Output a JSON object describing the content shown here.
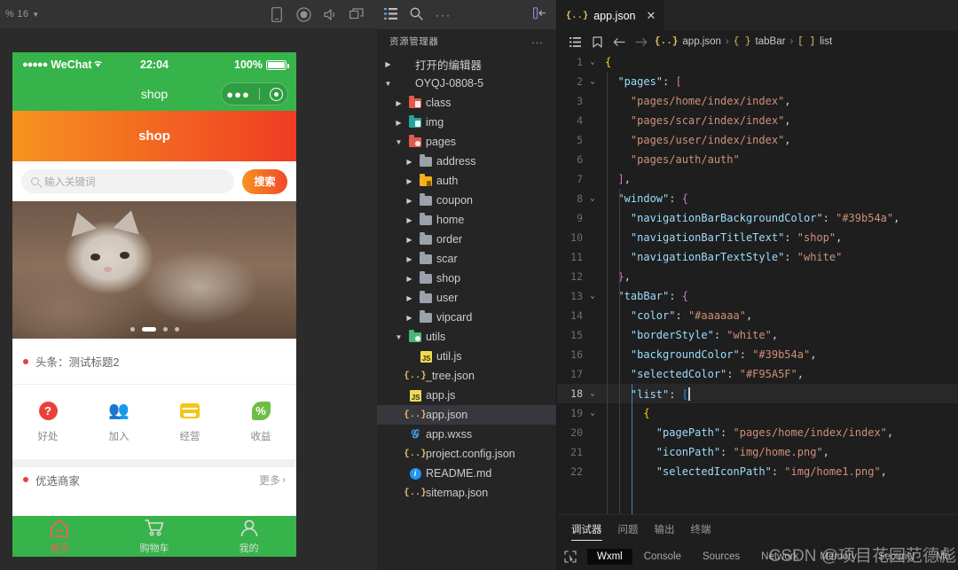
{
  "simulator": {
    "scale_label": "% 16",
    "toolbar_icons": [
      "device-icon",
      "record-icon",
      "volume-icon",
      "windows-icon"
    ],
    "status_bar": {
      "signal_dots": "●●●●●",
      "carrier": "WeChat",
      "wifi": "⌃",
      "time": "22:04",
      "battery_percent": "100%"
    },
    "nav_title": "shop",
    "banner_title": "shop",
    "search": {
      "placeholder": "输入关键词",
      "button_label": "搜索"
    },
    "carousel": {
      "dot_count": 4,
      "active_dot": 2
    },
    "news": {
      "text": "头条：测试标题2"
    },
    "quick_actions": [
      {
        "label": "好处",
        "icon": "help-icon",
        "color": "#e8413a"
      },
      {
        "label": "加入",
        "icon": "join-people-icon",
        "color": "#f7803c"
      },
      {
        "label": "经营",
        "icon": "store-icon",
        "color": "#f5c518"
      },
      {
        "label": "收益",
        "icon": "profit-percent-icon",
        "color": "#6fbe44"
      }
    ],
    "section": {
      "title": "优选商家",
      "more_label": "更多"
    },
    "tabbar": {
      "background": "#36b34a",
      "selected_color": "#F95A5F",
      "items": [
        {
          "label": "首页",
          "icon": "home-icon",
          "selected": true
        },
        {
          "label": "购物车",
          "icon": "cart-icon",
          "selected": false
        },
        {
          "label": "我的",
          "icon": "user-icon",
          "selected": false
        }
      ]
    }
  },
  "explorer": {
    "actions": [
      "list-icon",
      "search-icon",
      "more-icon",
      "collapse-sidebar-icon"
    ],
    "title": "资源管理器",
    "more_label": "...",
    "tree": [
      {
        "label": "打开的编辑器",
        "depth": 0,
        "twisty": "▶",
        "icon": "none",
        "selected": false
      },
      {
        "label": "OYQJ-0808-5",
        "depth": 0,
        "twisty": "▼",
        "icon": "none",
        "selected": false
      },
      {
        "label": "class",
        "depth": 1,
        "twisty": "▶",
        "icon": "folder-red",
        "selected": false
      },
      {
        "label": "img",
        "depth": 1,
        "twisty": "▶",
        "icon": "folder-green",
        "selected": false
      },
      {
        "label": "pages",
        "depth": 1,
        "twisty": "▼",
        "icon": "folder-red-open",
        "selected": false
      },
      {
        "label": "address",
        "depth": 2,
        "twisty": "▶",
        "icon": "folder-grey",
        "selected": false
      },
      {
        "label": "auth",
        "depth": 2,
        "twisty": "▶",
        "icon": "folder-yellow-lock",
        "selected": false
      },
      {
        "label": "coupon",
        "depth": 2,
        "twisty": "▶",
        "icon": "folder-grey",
        "selected": false
      },
      {
        "label": "home",
        "depth": 2,
        "twisty": "▶",
        "icon": "folder-grey",
        "selected": false
      },
      {
        "label": "order",
        "depth": 2,
        "twisty": "▶",
        "icon": "folder-grey",
        "selected": false
      },
      {
        "label": "scar",
        "depth": 2,
        "twisty": "▶",
        "icon": "folder-grey",
        "selected": false
      },
      {
        "label": "shop",
        "depth": 2,
        "twisty": "▶",
        "icon": "folder-grey",
        "selected": false
      },
      {
        "label": "user",
        "depth": 2,
        "twisty": "▶",
        "icon": "folder-grey",
        "selected": false
      },
      {
        "label": "vipcard",
        "depth": 2,
        "twisty": "▶",
        "icon": "folder-grey",
        "selected": false
      },
      {
        "label": "utils",
        "depth": 1,
        "twisty": "▼",
        "icon": "folder-green-open",
        "selected": false
      },
      {
        "label": "util.js",
        "depth": 2,
        "twisty": "",
        "icon": "js-file",
        "selected": false
      },
      {
        "label": "_tree.json",
        "depth": 1,
        "twisty": "",
        "icon": "json-file",
        "selected": false
      },
      {
        "label": "app.js",
        "depth": 1,
        "twisty": "",
        "icon": "js-file",
        "selected": false
      },
      {
        "label": "app.json",
        "depth": 1,
        "twisty": "",
        "icon": "json-file",
        "selected": true
      },
      {
        "label": "app.wxss",
        "depth": 1,
        "twisty": "",
        "icon": "css-file",
        "selected": false
      },
      {
        "label": "project.config.json",
        "depth": 1,
        "twisty": "",
        "icon": "json-file",
        "selected": false
      },
      {
        "label": "README.md",
        "depth": 1,
        "twisty": "",
        "icon": "md-file",
        "selected": false
      },
      {
        "label": "sitemap.json",
        "depth": 1,
        "twisty": "",
        "icon": "json-file",
        "selected": false
      }
    ]
  },
  "editor": {
    "tab": {
      "label": "app.json",
      "icon": "json-file",
      "close": "✕"
    },
    "breadcrumb": {
      "file": "app.json",
      "sep": "›",
      "obj_token": "{ }",
      "obj_name": "tabBar",
      "arr_token": "[ ]",
      "arr_name": "list"
    },
    "lines": [
      {
        "n": 1,
        "fold": "⌄",
        "indent": 0,
        "active": false,
        "tokens": [
          {
            "t": "{",
            "c": "b1"
          }
        ]
      },
      {
        "n": 2,
        "fold": "⌄",
        "indent": 1,
        "active": false,
        "tokens": [
          {
            "t": "\"pages\"",
            "c": "k"
          },
          {
            "t": ": ",
            "c": "p"
          },
          {
            "t": "[",
            "c": "b2"
          }
        ]
      },
      {
        "n": 3,
        "fold": "",
        "indent": 2,
        "active": false,
        "tokens": [
          {
            "t": "\"pages/home/index/index\"",
            "c": "s"
          },
          {
            "t": ",",
            "c": "p"
          }
        ]
      },
      {
        "n": 4,
        "fold": "",
        "indent": 2,
        "active": false,
        "tokens": [
          {
            "t": "\"pages/scar/index/index\"",
            "c": "s"
          },
          {
            "t": ",",
            "c": "p"
          }
        ]
      },
      {
        "n": 5,
        "fold": "",
        "indent": 2,
        "active": false,
        "tokens": [
          {
            "t": "\"pages/user/index/index\"",
            "c": "s"
          },
          {
            "t": ",",
            "c": "p"
          }
        ]
      },
      {
        "n": 6,
        "fold": "",
        "indent": 2,
        "active": false,
        "tokens": [
          {
            "t": "\"pages/auth/auth\"",
            "c": "s"
          }
        ]
      },
      {
        "n": 7,
        "fold": "",
        "indent": 1,
        "active": false,
        "tokens": [
          {
            "t": "]",
            "c": "b2"
          },
          {
            "t": ",",
            "c": "p"
          }
        ]
      },
      {
        "n": 8,
        "fold": "⌄",
        "indent": 1,
        "active": false,
        "tokens": [
          {
            "t": "\"window\"",
            "c": "k"
          },
          {
            "t": ": ",
            "c": "p"
          },
          {
            "t": "{",
            "c": "b2"
          }
        ]
      },
      {
        "n": 9,
        "fold": "",
        "indent": 2,
        "active": false,
        "tokens": [
          {
            "t": "\"navigationBarBackgroundColor\"",
            "c": "k"
          },
          {
            "t": ": ",
            "c": "p"
          },
          {
            "t": "\"#39b54a\"",
            "c": "s"
          },
          {
            "t": ",",
            "c": "p"
          }
        ]
      },
      {
        "n": 10,
        "fold": "",
        "indent": 2,
        "active": false,
        "tokens": [
          {
            "t": "\"navigationBarTitleText\"",
            "c": "k"
          },
          {
            "t": ": ",
            "c": "p"
          },
          {
            "t": "\"shop\"",
            "c": "s"
          },
          {
            "t": ",",
            "c": "p"
          }
        ]
      },
      {
        "n": 11,
        "fold": "",
        "indent": 2,
        "active": false,
        "tokens": [
          {
            "t": "\"navigationBarTextStyle\"",
            "c": "k"
          },
          {
            "t": ": ",
            "c": "p"
          },
          {
            "t": "\"white\"",
            "c": "s"
          }
        ]
      },
      {
        "n": 12,
        "fold": "",
        "indent": 1,
        "active": false,
        "tokens": [
          {
            "t": "}",
            "c": "b2"
          },
          {
            "t": ",",
            "c": "p"
          }
        ]
      },
      {
        "n": 13,
        "fold": "⌄",
        "indent": 1,
        "active": false,
        "tokens": [
          {
            "t": "\"tabBar\"",
            "c": "k"
          },
          {
            "t": ": ",
            "c": "p"
          },
          {
            "t": "{",
            "c": "b2"
          }
        ]
      },
      {
        "n": 14,
        "fold": "",
        "indent": 2,
        "active": false,
        "tokens": [
          {
            "t": "\"color\"",
            "c": "k"
          },
          {
            "t": ": ",
            "c": "p"
          },
          {
            "t": "\"#aaaaaa\"",
            "c": "s"
          },
          {
            "t": ",",
            "c": "p"
          }
        ]
      },
      {
        "n": 15,
        "fold": "",
        "indent": 2,
        "active": false,
        "tokens": [
          {
            "t": "\"borderStyle\"",
            "c": "k"
          },
          {
            "t": ": ",
            "c": "p"
          },
          {
            "t": "\"white\"",
            "c": "s"
          },
          {
            "t": ",",
            "c": "p"
          }
        ]
      },
      {
        "n": 16,
        "fold": "",
        "indent": 2,
        "active": false,
        "tokens": [
          {
            "t": "\"backgroundColor\"",
            "c": "k"
          },
          {
            "t": ": ",
            "c": "p"
          },
          {
            "t": "\"#39b54a\"",
            "c": "s"
          },
          {
            "t": ",",
            "c": "p"
          }
        ]
      },
      {
        "n": 17,
        "fold": "",
        "indent": 2,
        "active": false,
        "tokens": [
          {
            "t": "\"selectedColor\"",
            "c": "k"
          },
          {
            "t": ": ",
            "c": "p"
          },
          {
            "t": "\"#F95A5F\"",
            "c": "s"
          },
          {
            "t": ",",
            "c": "p"
          }
        ]
      },
      {
        "n": 18,
        "fold": "⌄",
        "indent": 2,
        "active": true,
        "tokens": [
          {
            "t": "\"list\"",
            "c": "k"
          },
          {
            "t": ": ",
            "c": "p"
          },
          {
            "t": "[",
            "c": "b3"
          },
          {
            "t": "|cursor|",
            "c": "cur"
          }
        ]
      },
      {
        "n": 19,
        "fold": "⌄",
        "indent": 3,
        "active": false,
        "tokens": [
          {
            "t": "{",
            "c": "b1"
          }
        ]
      },
      {
        "n": 20,
        "fold": "",
        "indent": 4,
        "active": false,
        "tokens": [
          {
            "t": "\"pagePath\"",
            "c": "k"
          },
          {
            "t": ": ",
            "c": "p"
          },
          {
            "t": "\"pages/home/index/index\"",
            "c": "s"
          },
          {
            "t": ",",
            "c": "p"
          }
        ]
      },
      {
        "n": 21,
        "fold": "",
        "indent": 4,
        "active": false,
        "tokens": [
          {
            "t": "\"iconPath\"",
            "c": "k"
          },
          {
            "t": ": ",
            "c": "p"
          },
          {
            "t": "\"img/home.png\"",
            "c": "s"
          },
          {
            "t": ",",
            "c": "p"
          }
        ]
      },
      {
        "n": 22,
        "fold": "",
        "indent": 4,
        "active": false,
        "tokens": [
          {
            "t": "\"selectedIconPath\"",
            "c": "k"
          },
          {
            "t": ": ",
            "c": "p"
          },
          {
            "t": "\"img/home1.png\"",
            "c": "s"
          },
          {
            "t": ",",
            "c": "p"
          }
        ]
      }
    ]
  },
  "panel": {
    "tabs": [
      {
        "label": "调试器",
        "active": true
      },
      {
        "label": "问题",
        "active": false
      },
      {
        "label": "输出",
        "active": false
      },
      {
        "label": "终端",
        "active": false
      }
    ],
    "devtools": {
      "inspect_icon": "inspect-element-icon",
      "tabs": [
        {
          "label": "Wxml",
          "active": true
        },
        {
          "label": "Console",
          "active": false
        },
        {
          "label": "Sources",
          "active": false
        },
        {
          "label": "Network",
          "active": false
        },
        {
          "label": "Memory",
          "active": false
        },
        {
          "label": "Security",
          "active": false
        },
        {
          "label": "Mo",
          "active": false
        }
      ]
    },
    "watermark": "CSDN @项目花园范德彪"
  }
}
